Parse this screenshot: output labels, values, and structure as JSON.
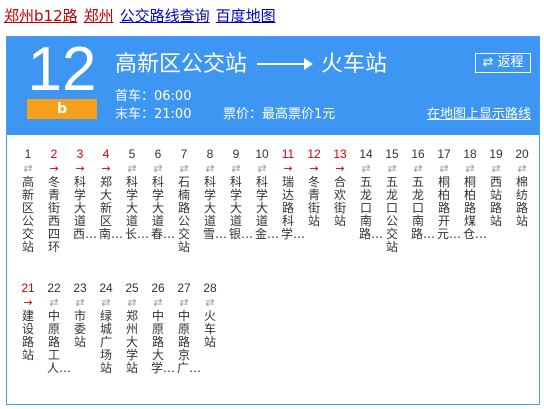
{
  "header_links": {
    "route": "郑州b12路",
    "city": "郑州",
    "query": "公交路线查询",
    "map": "百度地图"
  },
  "route": {
    "number": "12",
    "badge": "b",
    "from": "高新区公交站",
    "to": "火车站",
    "reverse_label": "⇄ 返程",
    "first_bus": "首车：06:00",
    "last_bus": "末车：21:00",
    "fare": "票价：最高票价1元",
    "map_link": "在地图上显示路线"
  },
  "stops": [
    {
      "num": "1",
      "name": "高新区公交站",
      "red": false
    },
    {
      "num": "2",
      "name": "冬青街西四环",
      "red": true
    },
    {
      "num": "3",
      "name": "科学大道西…",
      "red": true
    },
    {
      "num": "4",
      "name": "郑大新区南…",
      "red": true
    },
    {
      "num": "5",
      "name": "科学大道长…",
      "red": false
    },
    {
      "num": "6",
      "name": "科学大道春…",
      "red": false
    },
    {
      "num": "7",
      "name": "石楠路公交站",
      "red": false
    },
    {
      "num": "8",
      "name": "科学大道雪…",
      "red": false
    },
    {
      "num": "9",
      "name": "科学大道银…",
      "red": false
    },
    {
      "num": "10",
      "name": "科学大道金…",
      "red": false
    },
    {
      "num": "11",
      "name": "瑞达路科学…",
      "red": true
    },
    {
      "num": "12",
      "name": "冬青街站",
      "red": true
    },
    {
      "num": "13",
      "name": "合欢街站",
      "red": true
    },
    {
      "num": "14",
      "name": "五龙口南路…",
      "red": false
    },
    {
      "num": "15",
      "name": "五龙口公交站",
      "red": false
    },
    {
      "num": "16",
      "name": "五龙口南路…",
      "red": false
    },
    {
      "num": "17",
      "name": "桐柏路开元…",
      "red": false
    },
    {
      "num": "18",
      "name": "桐柏路煤仓…",
      "red": false
    },
    {
      "num": "19",
      "name": "西站路站",
      "red": false
    },
    {
      "num": "20",
      "name": "棉纺路站",
      "red": false
    },
    {
      "num": "21",
      "name": "建设路站",
      "red": true
    },
    {
      "num": "22",
      "name": "中原路工人…",
      "red": false
    },
    {
      "num": "23",
      "name": "市委站",
      "red": false
    },
    {
      "num": "24",
      "name": "绿城广场站",
      "red": false
    },
    {
      "num": "25",
      "name": "郑州大学站",
      "red": false
    },
    {
      "num": "26",
      "name": "中原路大学…",
      "red": false
    },
    {
      "num": "27",
      "name": "中原路京广…",
      "red": false
    },
    {
      "num": "28",
      "name": "火车站",
      "red": false
    }
  ]
}
